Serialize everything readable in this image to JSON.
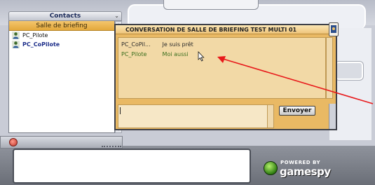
{
  "contacts": {
    "header_label": "Contacts",
    "group_label": "Salle de briefing",
    "items": [
      {
        "label": "PC_Pilote"
      },
      {
        "label": "PC_CoPilote"
      }
    ]
  },
  "conversation": {
    "title": "CONVERSATION DE SALLE DE BRIEFING TEST MULTI 01",
    "messages": [
      {
        "sender": "PC_CoPil...",
        "text": "Je suis prêt"
      },
      {
        "sender": "PC_Pilote",
        "text": "Moi aussi"
      }
    ],
    "input_value": "",
    "send_label": "Envoyer"
  },
  "branding": {
    "powered_by": "POWERED BY",
    "name": "gamespy"
  },
  "colors": {
    "annotation_arrow": "#e8191b",
    "conversation_bg": "#e9b964",
    "group_header": "#f4c66d"
  }
}
